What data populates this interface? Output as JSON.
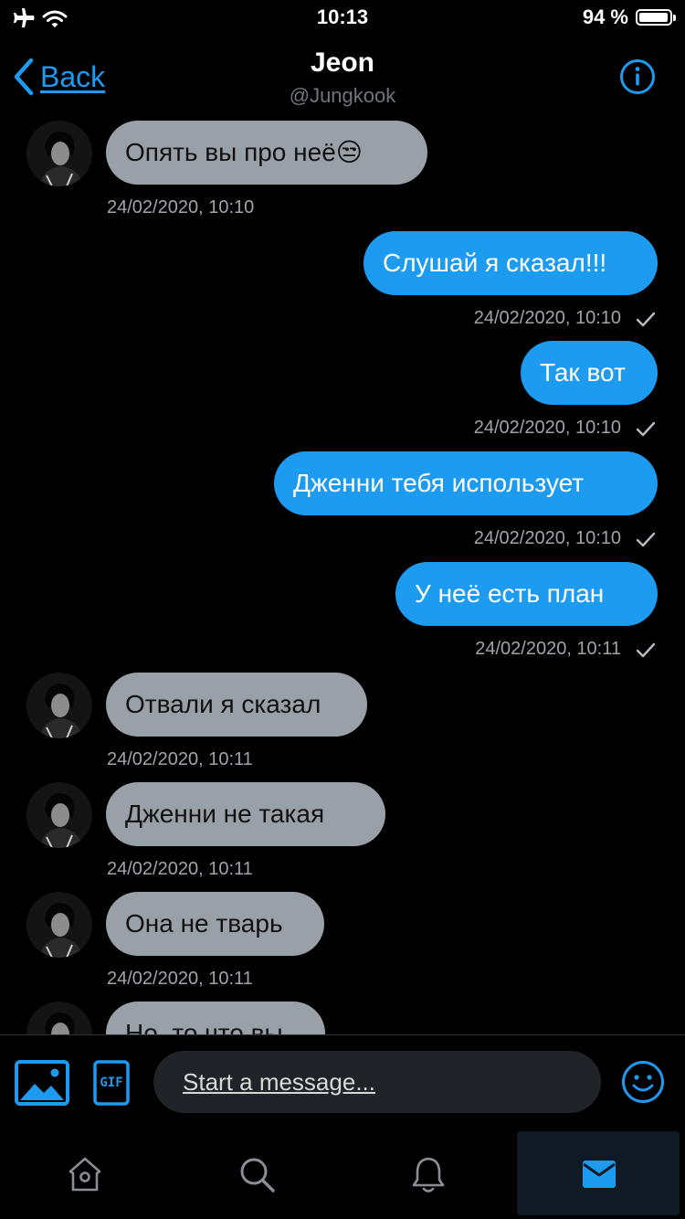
{
  "status_bar": {
    "time": "10:13",
    "battery": "94 %",
    "battery_level": 0.94
  },
  "header": {
    "back_label": "Back",
    "name": "Jeon",
    "handle": "@Jungkook",
    "info_icon": "info-icon"
  },
  "messages": [
    {
      "side": "received",
      "text": "Опять вы про неё😒",
      "time": "24/02/2020, 10:10"
    },
    {
      "side": "sent",
      "text": "Слушай я сказал!!!",
      "time": "24/02/2020, 10:10"
    },
    {
      "side": "sent",
      "text": "Так вот",
      "time": "24/02/2020, 10:10"
    },
    {
      "side": "sent",
      "text": "Дженни тебя использует",
      "time": "24/02/2020, 10:10"
    },
    {
      "side": "sent",
      "text": "У неё есть план",
      "time": "24/02/2020, 10:11"
    },
    {
      "side": "received",
      "text": "Отвали я сказал",
      "time": "24/02/2020, 10:11"
    },
    {
      "side": "received",
      "text": "Дженни не такая",
      "time": "24/02/2020, 10:11"
    },
    {
      "side": "received",
      "text": "Она не тварь",
      "time": "24/02/2020, 10:11"
    },
    {
      "side": "received",
      "text": "Но, то что вы",
      "time": ""
    }
  ],
  "composer": {
    "placeholder": "Start a message...",
    "gif_label": "GIF"
  },
  "tabs": [
    {
      "name": "home",
      "icon": "home-icon"
    },
    {
      "name": "search",
      "icon": "search-icon"
    },
    {
      "name": "notifications",
      "icon": "bell-icon"
    },
    {
      "name": "messages",
      "icon": "mail-icon",
      "active": true
    }
  ],
  "colors": {
    "accent": "#1d9bf0",
    "received_bubble": "#9aa0a8",
    "background": "#000000"
  }
}
